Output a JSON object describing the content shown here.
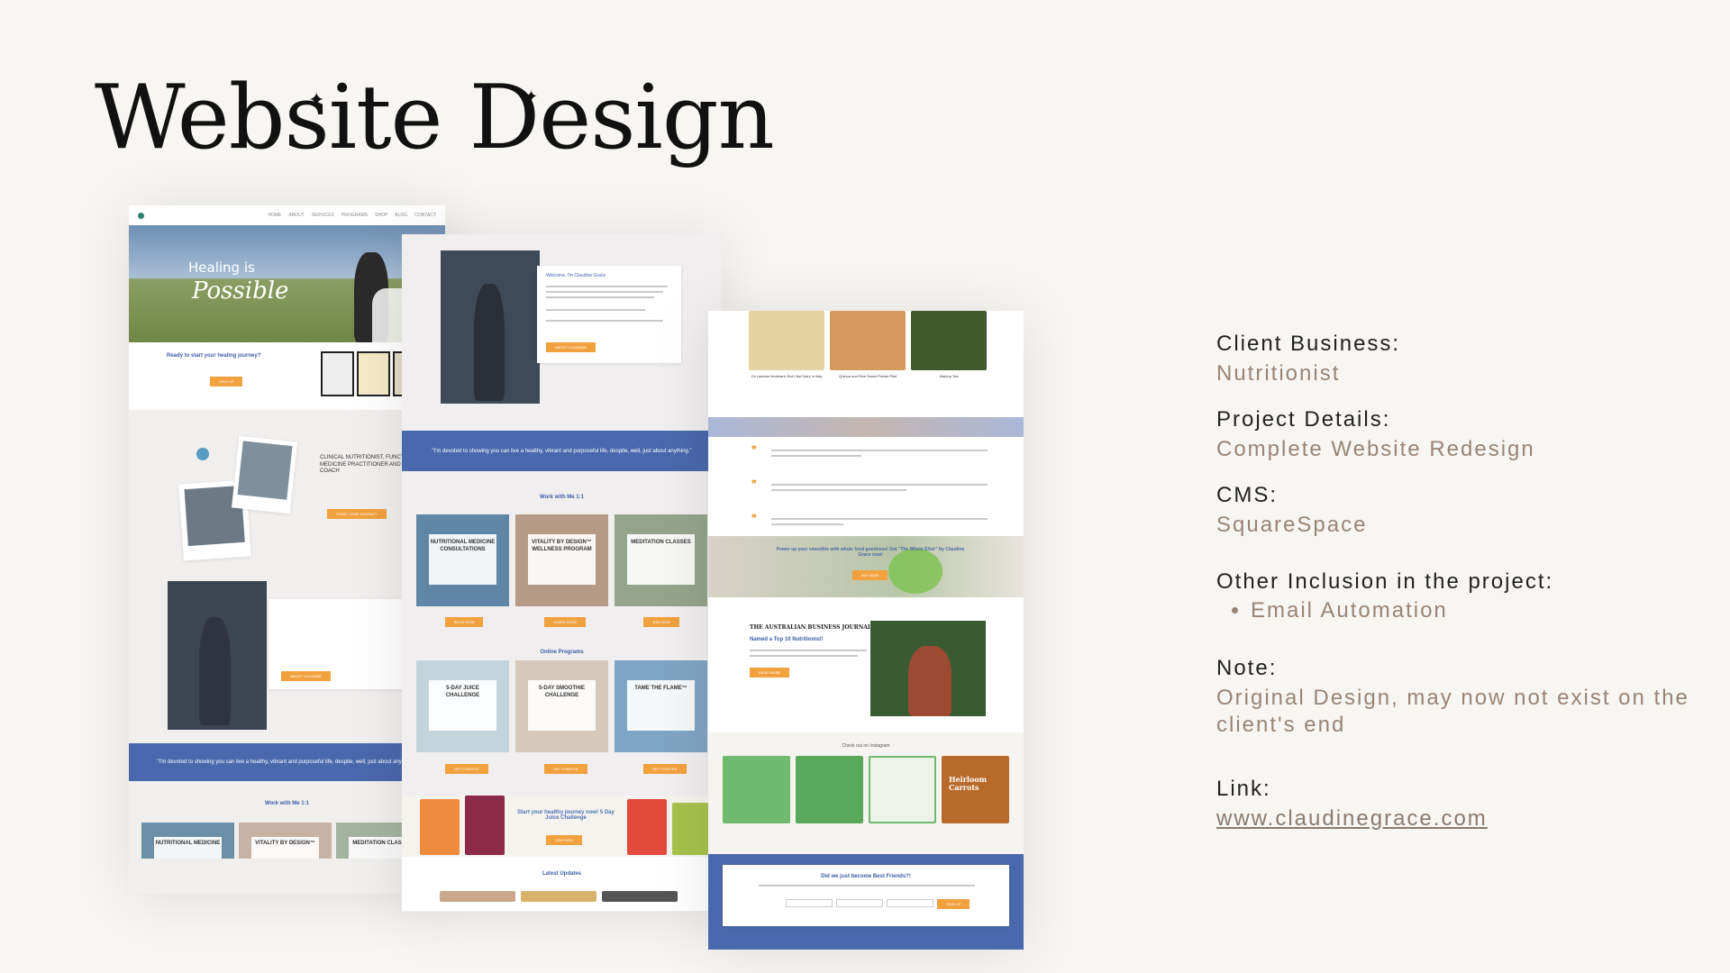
{
  "page": {
    "title": "Website Design"
  },
  "info": {
    "client_label": "Client Business:",
    "client_value": "Nutritionist",
    "project_label": "Project Details:",
    "project_value": "Complete Website Redesign",
    "cms_label": "CMS:",
    "cms_value": "SquareSpace",
    "other_label": "Other Inclusion in the project:",
    "other_items": [
      "Email Automation"
    ],
    "note_label": "Note:",
    "note_value": "Original Design, may now not exist on the client's end",
    "link_label": "Link:",
    "link_value": "www.claudinegrace.com"
  },
  "mockup1": {
    "hero_line1": "Healing is",
    "hero_line2": "Possible",
    "ready_text": "Ready to start your healing journey?",
    "about_heading": "CLINICAL NUTRITIONIST, FUNCTIONAL MEDICINE PRACTITIONER AND HEALTH COACH",
    "quote": "\"I'm devoted to showing you can live a healthy, vibrant and purposeful life, despite, well, just about anything.\"",
    "work_heading": "Work with Me 1:1",
    "tiles": [
      "NUTRITIONAL MEDICINE",
      "VITALITY BY DESIGN™",
      "MEDITATION CLASSES"
    ]
  },
  "mockup2": {
    "welcome": "Welcome, I'm Claudine Grace",
    "quote": "\"I'm devoted to showing you can live a healthy, vibrant and purposeful life, despite, well, just about anything.\"",
    "work_heading": "Work with Me 1:1",
    "tiles": [
      "NUTRITIONAL MEDICINE CONSULTATIONS",
      "VITALITY BY DESIGN™ WELLNESS PROGRAM",
      "MEDITATION CLASSES"
    ],
    "online_heading": "Online Programs",
    "online_tiles": [
      "5-DAY JUICE CHALLENGE",
      "5-DAY SMOOTHIE CHALLENGE",
      "TAME THE FLAME™"
    ],
    "juice_banner": "Start your healthy journey now! 5 Day Juice Challenge",
    "latest": "Latest Updates"
  },
  "mockup3": {
    "foods": [
      "I'm Lactose Intolerant, But I like Dairy in Italy",
      "Quinoa and Rice Sweet Potato Pilaf",
      "Matcha Tea"
    ],
    "smoothie_banner": "Power up your smoothie with whole food goodness! Get \"The Whole Elixir\" by Claudine Grace now!",
    "journal_name": "THE AUSTRALIAN BUSINESS JOURNAL",
    "journal_text": "Named a Top 10 Nutritionist!",
    "instagram": "Check out on Instagram",
    "insta_tiles": [
      "Heirloom Carrots"
    ],
    "newsletter": "Did we just become Best Friends?!"
  },
  "colors": {
    "accent": "#f2a13f",
    "brand_blue": "#4a68ad",
    "info_value": "#9a8474",
    "background": "#f8f6f2"
  }
}
